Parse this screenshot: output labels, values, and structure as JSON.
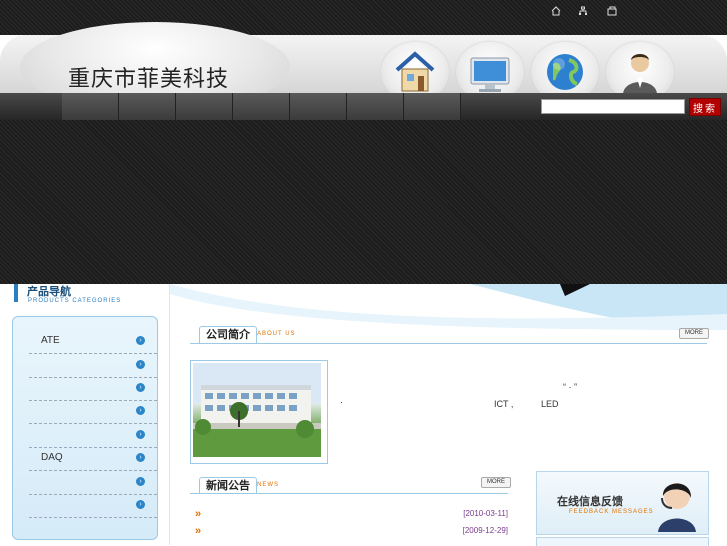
{
  "site": {
    "title": "重庆市菲美科技"
  },
  "top_links": [
    {
      "icon": "home-small-icon"
    },
    {
      "icon": "sitemap-icon"
    },
    {
      "icon": "bookmark-icon"
    }
  ],
  "nav_icons": [
    "house-icon",
    "monitor-icon",
    "globe-icon",
    "user-icon"
  ],
  "search": {
    "button_label": "搜索",
    "placeholder": ""
  },
  "sidebar": {
    "heading_cn": "产品导航",
    "heading_en": "PRODUCTS CATEGORIES",
    "categories": [
      {
        "label": "ATE"
      },
      {
        "label": ""
      },
      {
        "label": ""
      },
      {
        "label": ""
      },
      {
        "label": ""
      },
      {
        "label": "DAQ"
      },
      {
        "label": ""
      },
      {
        "label": ""
      }
    ]
  },
  "about": {
    "title": "公司简介",
    "subtitle": "ABOUT US",
    "more_label": "MORE",
    "text_quote": "“ · ”",
    "text_bullet": "·",
    "text_ict": "ICT ,",
    "text_led": "LED"
  },
  "news": {
    "title": "新闻公告",
    "subtitle": "NEWS",
    "more_label": "MORE",
    "items": [
      {
        "date": "[2010-03-11]"
      },
      {
        "date": "[2009-12-29]"
      }
    ]
  },
  "feedback": {
    "title": "在线信息反馈",
    "subtitle": "FEEDBACK MESSAGES"
  },
  "colors": {
    "accent_blue": "#2a85c9",
    "search_red": "#b30000",
    "news_date": "#7a3b8c",
    "orange": "#e07000"
  }
}
